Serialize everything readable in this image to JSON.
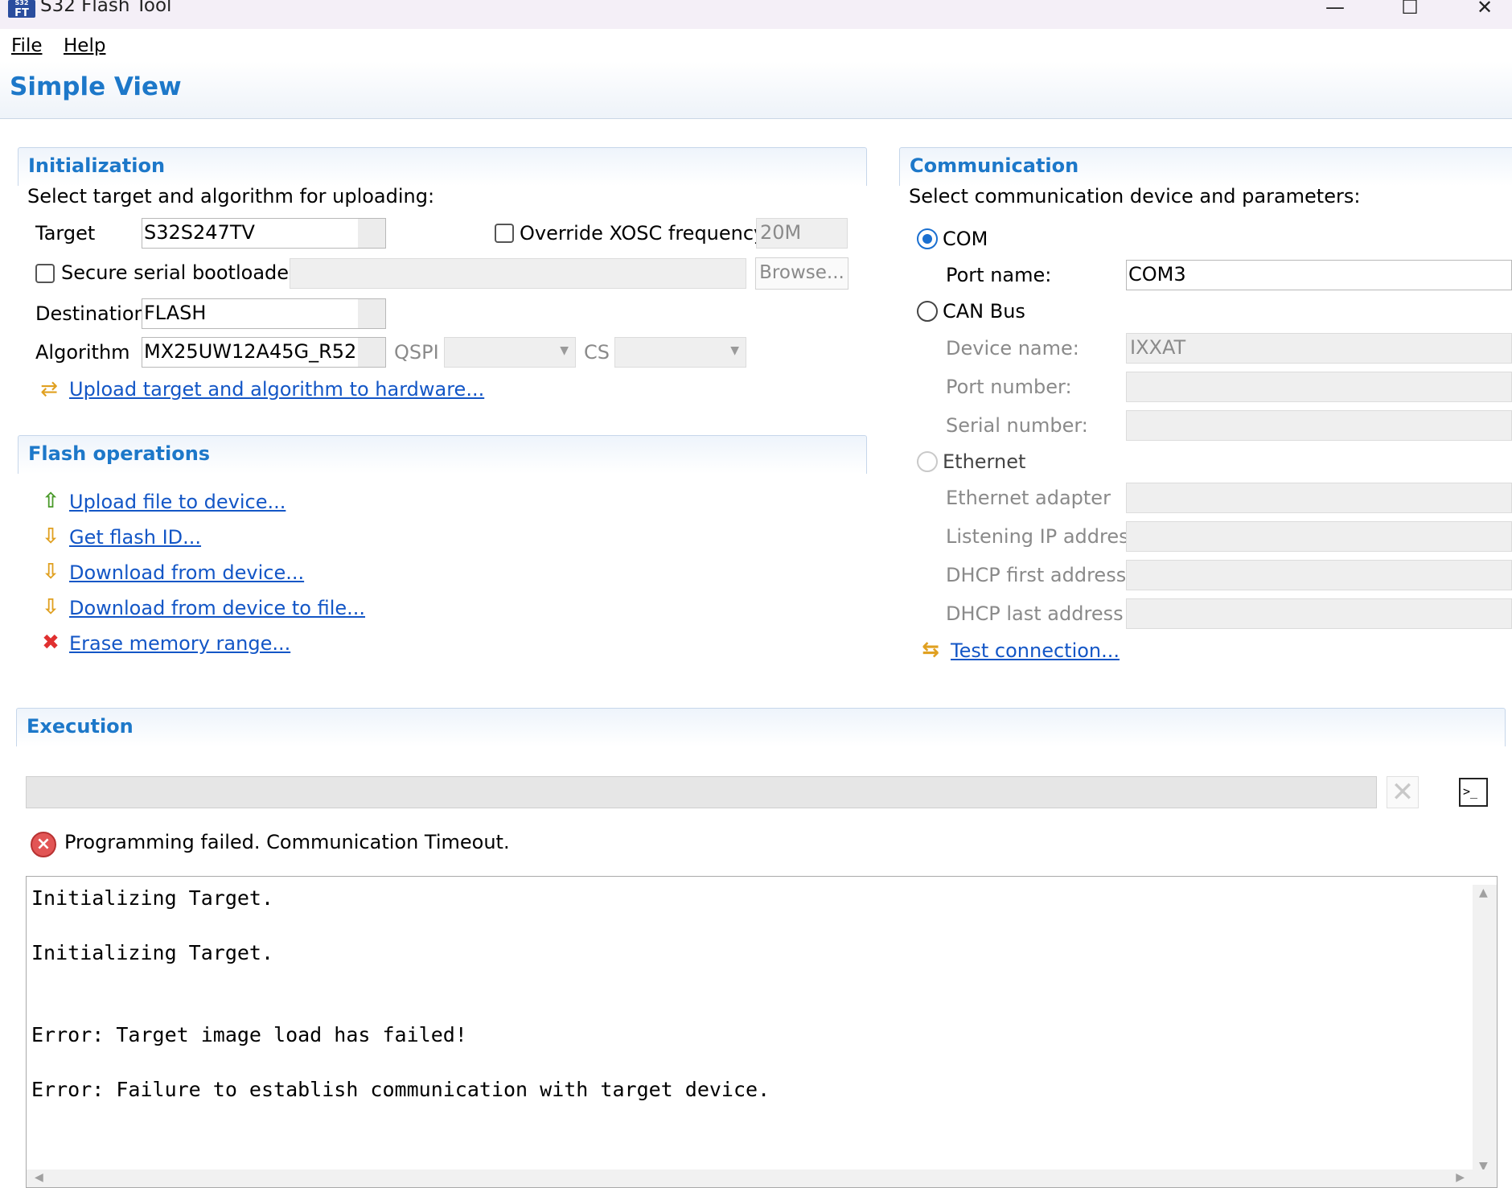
{
  "window": {
    "title": "S32 Flash Tool",
    "icon_text_top": "S32",
    "icon_text_bottom": "FT",
    "minimize": "—",
    "maximize": "☐",
    "close": "✕"
  },
  "menu": {
    "file": "File",
    "help": "Help"
  },
  "view_title": "Simple View",
  "initialization": {
    "title": "Initialization",
    "subtitle": "Select target and algorithm for uploading:",
    "target_label": "Target",
    "target_value": "S32S247TV",
    "override_label": "Override XOSC frequency",
    "override_checked": false,
    "xosc_value": "20M",
    "secure_label": "Secure serial bootloader:",
    "secure_checked": false,
    "browse_label": "Browse...",
    "destination_label": "Destination",
    "destination_value": "FLASH",
    "algorithm_label": "Algorithm",
    "algorithm_value": "MX25UW12A45G_R52",
    "qspi_label": "QSPI",
    "cs_label": "CS",
    "upload_link": "Upload target and algorithm to hardware..."
  },
  "flash_operations": {
    "title": "Flash operations",
    "items": [
      {
        "label": "Upload file to device...",
        "icon": "arrow-up-icon"
      },
      {
        "label": "Get flash ID...",
        "icon": "arrow-down-icon"
      },
      {
        "label": "Download from device...",
        "icon": "arrow-down-icon"
      },
      {
        "label": "Download from device to file...",
        "icon": "arrow-down-icon"
      },
      {
        "label": "Erase memory range...",
        "icon": "erase-x-icon"
      }
    ]
  },
  "communication": {
    "title": "Communication",
    "subtitle": "Select communication device and parameters:",
    "com_label": "COM",
    "selected": "COM",
    "port_name_label": "Port name:",
    "port_name_value": "COM3",
    "can_label": "CAN Bus",
    "device_name_label": "Device name:",
    "device_name_value": "IXXAT",
    "port_number_label": "Port number:",
    "serial_number_label": "Serial number:",
    "ethernet_label": "Ethernet",
    "ethernet_adapter_label": "Ethernet adapter",
    "listening_ip_label": "Listening IP address",
    "dhcp_first_label": "DHCP first address",
    "dhcp_last_label": "DHCP last address",
    "test_link": "Test connection..."
  },
  "execution": {
    "title": "Execution",
    "progress": 0,
    "status_message": "Programming failed. Communication Timeout.",
    "console_icon_text": ">_",
    "log": [
      "Initializing Target.",
      "Initializing Target.",
      "Error: Target image load has failed!",
      "Error: Failure to establish communication with target device."
    ]
  },
  "colors": {
    "accent": "#1d78c9",
    "link": "#1356c6",
    "error": "#e25555"
  }
}
